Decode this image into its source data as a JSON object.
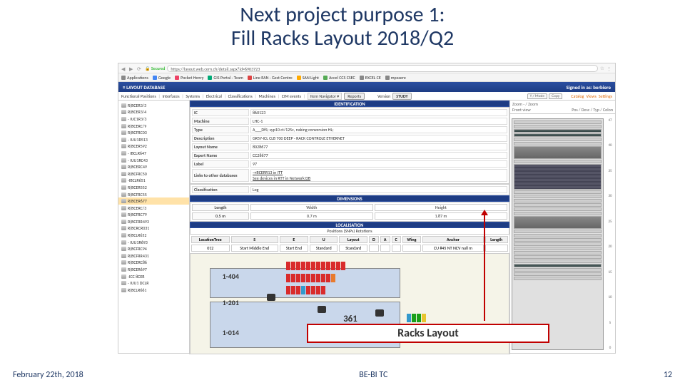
{
  "title_line1": "Next project purpose 1:",
  "title_line2": "Fill Racks Layout 2018/Q2",
  "browser": {
    "secure_label": "Secured",
    "url": "https://layout.web.cern.ch/detail.aspx?id=6903723",
    "bookmarks": [
      "Applications",
      "Google",
      "Pocket Henry",
      "GIS Portal - Team",
      "Line EAN - Gest Centre",
      "SAN Light",
      "Accel CCS CSEC",
      "EXCEL CE",
      "mpasere"
    ]
  },
  "app": {
    "title": "LAYOUT DATABASE",
    "signed": "Signed in as: berbiere",
    "menu": [
      "Functional Positions",
      "Interfaces",
      "Systems",
      "Electrical",
      "Classifications",
      "Machines",
      "CIM events"
    ],
    "dropdown": "Item Navigator",
    "go": "Reports",
    "version_label": "Version",
    "version_value": "STUDY",
    "tabs": [
      "Y / Mode",
      "Copy"
    ],
    "right_links": [
      "Catalog",
      "Views",
      "Settings"
    ]
  },
  "tree": [
    "R(BCER3/3",
    "R(BCER3/4",
    "- IUC1R3/3",
    "R(BCERC/9",
    "R(BCFRC03",
    "- IUU1R513",
    "R(BCER592",
    "- IBCLR647",
    "- IUU1RC43",
    "R(BCERC49",
    "R(BCFRC50",
    "-IBCLR651",
    "R(BCER552",
    "R(BCFRC55",
    "R(BCER677",
    "R(BCERC/3",
    "R(BCFRC79",
    "R(BCFRR493",
    "R(BCRCR031",
    "R(BCLR652",
    "- IUU1R693",
    "R(BCFRC94",
    "R(BCFRR431",
    "R(BCERC86",
    "R(BCER697",
    "-ICC 8CER",
    "- IUU1 DCLR",
    "R(BCLR661"
  ],
  "tree_selected_index": 14,
  "ident": {
    "header": "IDENTIFICATION",
    "rows": [
      [
        "IC",
        "860123"
      ],
      [
        "Machine",
        "LHC-1"
      ],
      [
        "Type",
        "A___DfS; syp10 ct/125c, naking conversion HL;"
      ],
      [
        "Description",
        "GR5Y-ICL CLB 700 DEEP - RACK CONTROLE ETHERNET"
      ],
      [
        "Layout Name",
        "8028677"
      ],
      [
        "Expert Name",
        "CC28677"
      ],
      [
        "Label",
        "97"
      ],
      [
        "Links to other databases",
        "→BCERR13 in ITT\n See devices in RTT in Network DB"
      ]
    ],
    "class_header": "Classification",
    "class_val": "Log"
  },
  "dims": {
    "header": "DIMENSIONS",
    "cols": [
      "Length",
      "Width",
      "Height"
    ],
    "vals": [
      "0.5 m",
      "0.7 m",
      "1.87 m"
    ]
  },
  "loc": {
    "header": "LOCALISATION",
    "sub": "Positions (SNPs)       Rotations",
    "cols": [
      "LocationTree",
      "S",
      "E",
      "U",
      "Layout",
      "D",
      "A",
      "C",
      "Wing",
      "Anchor",
      "Length"
    ],
    "vals": [
      "012",
      "Start Middle End",
      "Start End",
      "Standard",
      "Standard",
      "",
      "",
      "",
      "",
      "CU #45 NT NCV null m",
      ""
    ]
  },
  "floor": {
    "rooms": [
      "1-404",
      "1-201",
      "1-014"
    ],
    "big_label": "361"
  },
  "rack": {
    "zoom": "Zoom - / Zoom",
    "front": "Front view",
    "topline": "Pos / Desc / Typ / Colon",
    "unit_top": "47",
    "unit_bot": "0"
  },
  "callout": "Racks Layout",
  "footer": {
    "left": "February 22th, 2018",
    "center": "BE-BI TC",
    "right": "12"
  }
}
